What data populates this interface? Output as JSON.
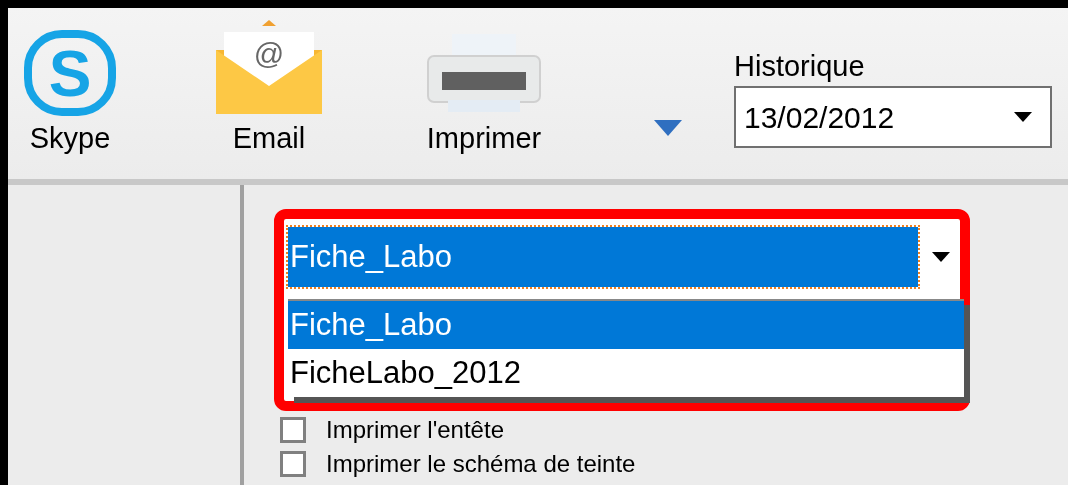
{
  "toolbar": {
    "buttons": [
      {
        "kind": "skype",
        "label": "Skype",
        "icon_text": "S"
      },
      {
        "kind": "email",
        "label": "Email",
        "icon_text": "@"
      },
      {
        "kind": "printer",
        "label": "Imprimer"
      }
    ],
    "history": {
      "label": "Historique",
      "value": "13/02/2012"
    }
  },
  "template_combo": {
    "value": "Fiche_Labo",
    "options": [
      {
        "label": "Fiche_Labo",
        "selected": true
      },
      {
        "label": "FicheLabo_2012",
        "selected": false
      }
    ]
  },
  "checkboxes": [
    {
      "label": "Imprimer l'entête",
      "checked": false
    },
    {
      "label": "Imprimer le schéma de teinte",
      "checked": false
    }
  ]
}
